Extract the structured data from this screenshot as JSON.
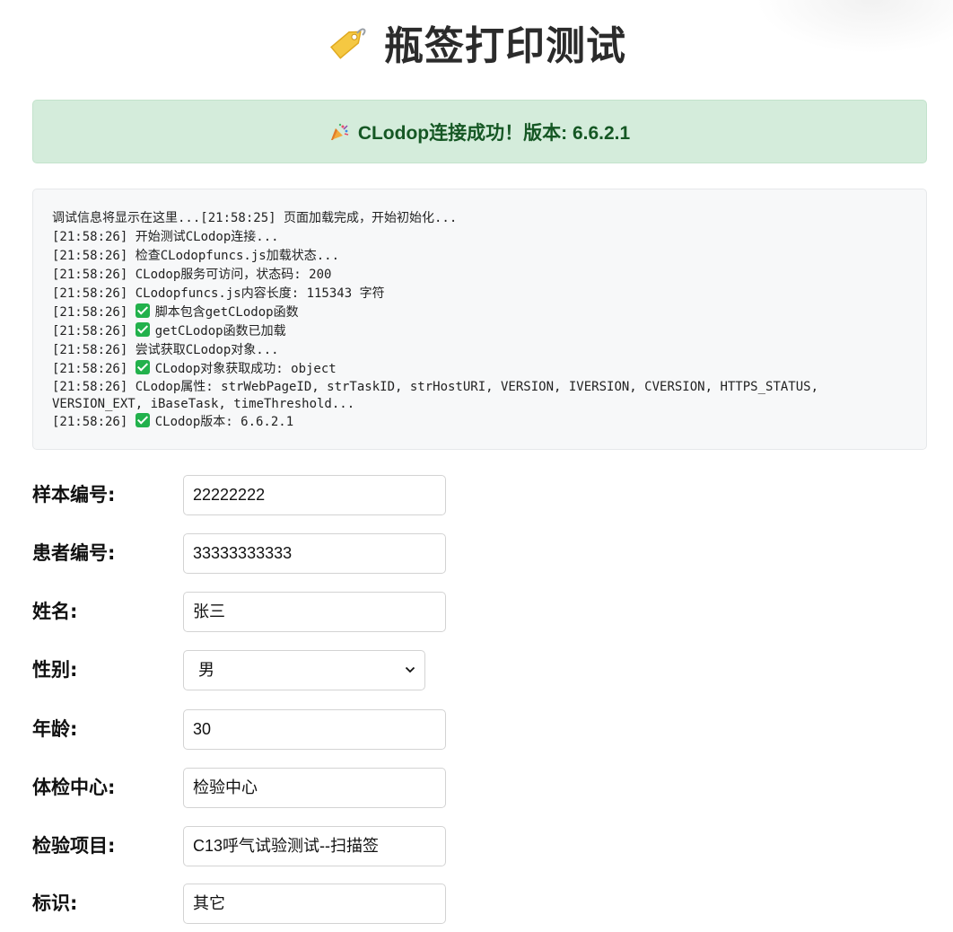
{
  "page": {
    "title": "瓶签打印测试",
    "title_icon": "tag-icon"
  },
  "status": {
    "message": "CLodop连接成功！版本: 6.6.2.1",
    "icon": "party-popper-icon",
    "color": "#155724",
    "background": "#d4ecdb"
  },
  "debug": {
    "lines": [
      "调试信息将显示在这里...[21:58:25] 页面加载完成，开始初始化...",
      "[21:58:26] 开始测试CLodop连接...",
      "[21:58:26] 检查CLodopfuncs.js加载状态...",
      "[21:58:26] CLodop服务可访问，状态码: 200",
      "[21:58:26] CLodopfuncs.js内容长度: 115343 字符",
      "脚本包含getCLodop函数",
      "getCLodop函数已加载",
      "[21:58:26] 尝试获取CLodop对象...",
      "CLodop对象获取成功: object",
      "[21:58:26] CLodop属性: strWebPageID, strTaskID, strHostURI, VERSION, IVERSION, CVERSION, HTTPS_STATUS, VERSION_EXT, iBaseTask, timeThreshold...",
      "CLodop版本: 6.6.2.1"
    ],
    "check_prefix": "[21:58:26] "
  },
  "form": {
    "sample_no": {
      "label": "样本编号:",
      "value": "22222222"
    },
    "patient_no": {
      "label": "患者编号:",
      "value": "33333333333"
    },
    "name": {
      "label": "姓名:",
      "value": "张三"
    },
    "gender": {
      "label": "性别:",
      "value": "男"
    },
    "age": {
      "label": "年龄:",
      "value": "30"
    },
    "center": {
      "label": "体检中心:",
      "value": "检验中心"
    },
    "item": {
      "label": "检验项目:",
      "value": "C13呼气试验测试--扫描签"
    },
    "mark": {
      "label": "标识:",
      "value": "其它"
    }
  }
}
